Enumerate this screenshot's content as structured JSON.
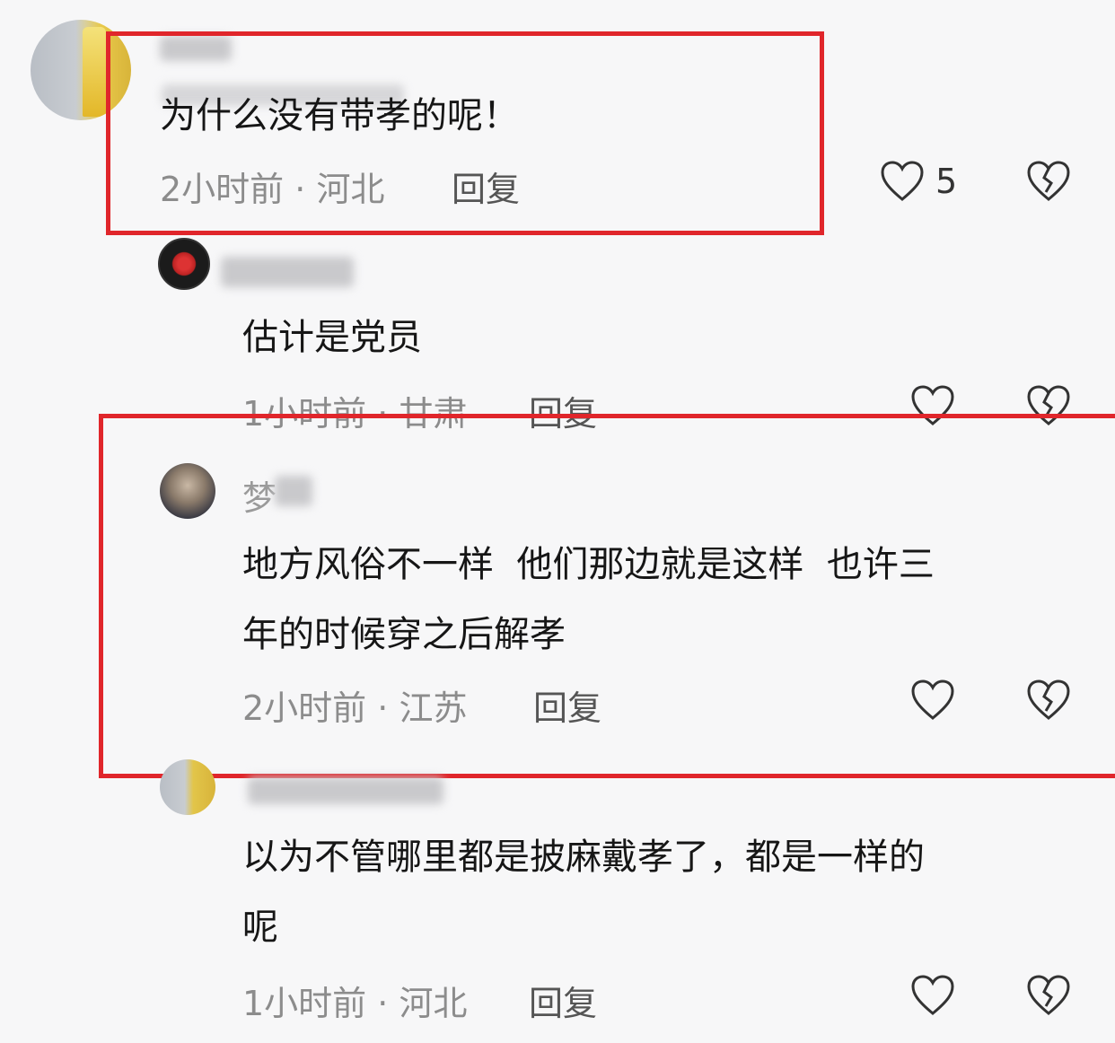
{
  "comments": [
    {
      "username_visible": "",
      "text": "为什么没有带孝的呢！",
      "time": "2小时前",
      "location": "河北",
      "reply_label": "回复",
      "like_count": "5"
    },
    {
      "username_visible": "",
      "text": "估计是党员",
      "time": "1小时前",
      "location": "甘肃",
      "reply_label": "回复",
      "like_count": ""
    },
    {
      "username_visible": "梦",
      "text_line1": "地方风俗不一样  他们那边就是这样  也许三",
      "text_line2": "年的时候穿之后解孝",
      "time": "2小时前",
      "location": "江苏",
      "reply_label": "回复",
      "like_count": ""
    },
    {
      "username_visible": "",
      "text_line1": "以为不管哪里都是披麻戴孝了，都是一样的",
      "text_line2": "呢",
      "time": "1小时前",
      "location": "河北",
      "reply_label": "回复",
      "like_count": ""
    }
  ],
  "separator": " · ",
  "icons": {
    "like": "heart-outline-icon",
    "dislike": "broken-heart-icon"
  },
  "colors": {
    "highlight_box": "#e0262b",
    "meta_text": "#8c8c8c",
    "background": "#f7f7f8"
  }
}
